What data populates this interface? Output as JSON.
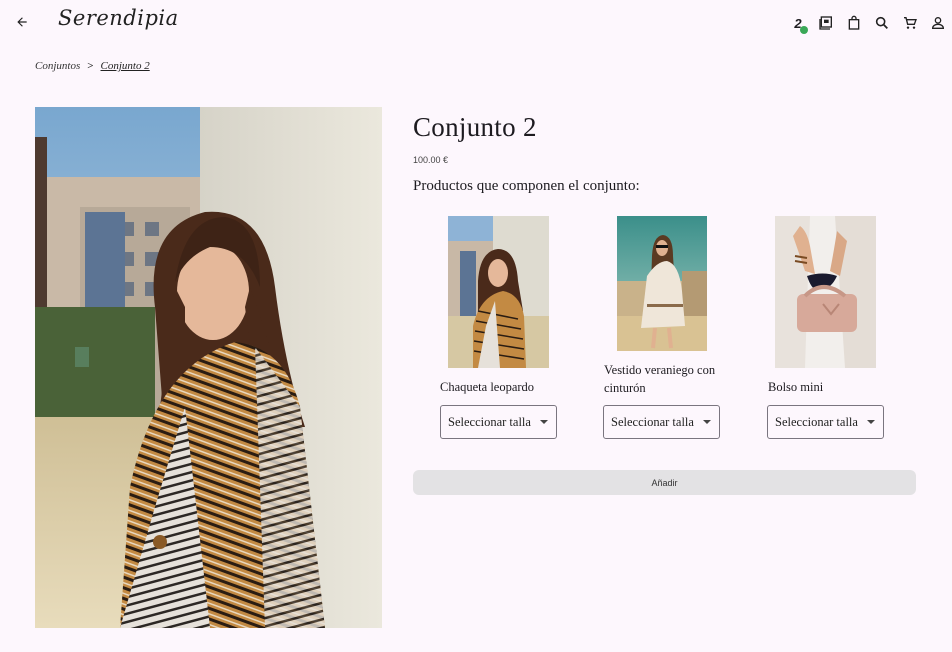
{
  "header": {
    "logo": "Serendipia",
    "back_icon": "arrow-left-icon",
    "actions": [
      {
        "name": "members-icon",
        "label": "2"
      },
      {
        "name": "portfolio-icon"
      },
      {
        "name": "shopping-bag-icon"
      },
      {
        "name": "search-icon"
      },
      {
        "name": "cart-icon"
      },
      {
        "name": "user-icon"
      }
    ],
    "badge_color": "#3aa757"
  },
  "breadcrumb": {
    "root": "Conjuntos",
    "separator": ">",
    "current": "Conjunto 2"
  },
  "product": {
    "title": "Conjunto 2",
    "price": "100.00 €",
    "subtitle": "Productos que componen el conjunto:",
    "items": [
      {
        "name": "Chaqueta leopardo",
        "select": "Seleccionar talla"
      },
      {
        "name": "Vestido veraniego con cinturón",
        "select": "Seleccionar talla"
      },
      {
        "name": "Bolso mini",
        "select": "Seleccionar talla"
      }
    ],
    "add_label": "Añadir"
  }
}
